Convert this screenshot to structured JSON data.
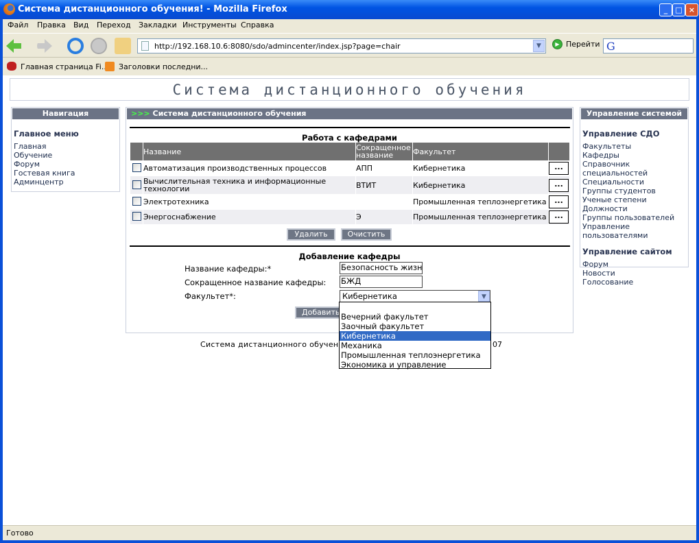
{
  "window": {
    "title": "Система дистанционного обучения! - Mozilla Firefox",
    "minimize": "_",
    "maximize": "□",
    "close": "×"
  },
  "menu": [
    "Файл",
    "Правка",
    "Вид",
    "Переход",
    "Закладки",
    "Инструменты",
    "Справка"
  ],
  "toolbar": {
    "url": "http://192.168.10.6:8080/sdo/admincenter/index.jsp?page=chair",
    "go_label": "Перейти",
    "search_logo": "G"
  },
  "bookmarks": [
    "Главная страница Fi...",
    "Заголовки последни..."
  ],
  "page": {
    "header": "Система дистанционного обучения"
  },
  "nav": {
    "title": "Навигация",
    "section": "Главное меню",
    "items": [
      "Главная",
      "Обучение",
      "Форум",
      "Гостевая книга",
      "Админцентр"
    ]
  },
  "center": {
    "title": "Система дистанционного обучения",
    "list_title": "Работа с кафедрами",
    "columns": [
      "",
      "Название",
      "Сокращенное название",
      "Факультет",
      ""
    ],
    "rows": [
      {
        "name": "Автоматизация производственных процессов",
        "short": "АПП",
        "faculty": "Кибернетика",
        "action": "..."
      },
      {
        "name": "Вычислительная техника и информационные технологии",
        "short": "ВТИТ",
        "faculty": "Кибернетика",
        "action": "..."
      },
      {
        "name": "Электротехника",
        "short": "",
        "faculty": "Промышленная теплоэнергетика",
        "action": "..."
      },
      {
        "name": "Энергоснабжение",
        "short": "Э",
        "faculty": "Промышленная теплоэнергетика",
        "action": "..."
      }
    ],
    "delete_label": "Удалить",
    "clear_label": "Очистить",
    "form_title": "Добавление кафедры",
    "name_label": "Название кафедры:*",
    "name_value": "Безопасность жизне,",
    "short_label": "Сокращенное название кафедры:",
    "short_value": "БЖД",
    "faculty_label": "Факультет*:",
    "faculty_value": "Кибернетика",
    "faculty_options": [
      "",
      "Вечерний факультет",
      "Заочный факультет",
      "Кибернетика",
      "Механика",
      "Промышленная теплоэнергетика",
      "Экономика и управление"
    ],
    "add_label": "Добавить"
  },
  "mgmt": {
    "title": "Управление системой",
    "sdo_section": "Управление СДО",
    "sdo_items": [
      "Факультеты",
      "Кафедры",
      "Справочник специальностей",
      "Специальности",
      "Группы студентов",
      "Ученые степени",
      "Должности",
      "Группы пользователей",
      "Управление пользователями"
    ],
    "site_section": "Управление сайтом",
    "site_items": [
      "Форум",
      "Новости",
      "Голосование"
    ]
  },
  "footer": {
    "left": "Система дистанционного обучения",
    "right": "07"
  },
  "status": "Готово",
  "colors": {
    "panel_header": "#6b7385",
    "selected": "#316ac5",
    "titlebar": "#0054e3"
  }
}
